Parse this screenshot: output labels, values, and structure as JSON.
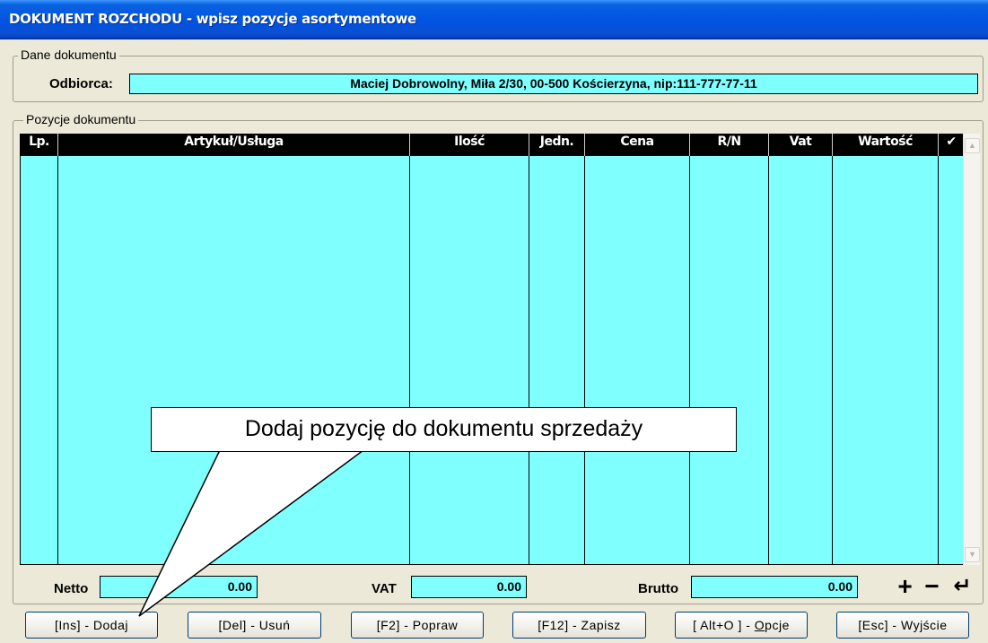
{
  "window": {
    "title": "DOKUMENT ROZCHODU - wpisz pozycje asortymentowe"
  },
  "dane": {
    "legend": "Dane dokumentu",
    "odbiorca_label": "Odbiorca:",
    "odbiorca_value": "Maciej Dobrowolny,  Miła 2/30,  00-500 Kościerzyna,  nip:111-777-77-11"
  },
  "pozycje": {
    "legend": "Pozycje dokumentu",
    "columns": [
      "Lp.",
      "Artykuł/Usługa",
      "Ilość",
      "Jedn.",
      "Cena",
      "R/N",
      "Vat",
      "Wartość",
      "✔"
    ],
    "rows": []
  },
  "totals": {
    "netto_label": "Netto",
    "netto_value": "0.00",
    "vat_label": "VAT",
    "vat_value": "0.00",
    "brutto_label": "Brutto",
    "brutto_value": "0.00"
  },
  "controls": {
    "plus": "+",
    "minus": "−",
    "enter": "↵"
  },
  "buttons": {
    "dodaj": "[Ins] - Dodaj",
    "usun": "[Del] - Usuń",
    "popraw": "[F2] - Popraw",
    "zapisz": "[F12] - Zapisz",
    "opcje_prefix": "[ Alt+O ] - ",
    "opcje_key": "O",
    "opcje_rest": "pcje",
    "wyjscie": "[Esc] - Wyjście"
  },
  "callout": {
    "text": "Dodaj pozycję do dokumentu sprzedaży"
  },
  "colors": {
    "field": "#80ffff",
    "titlebar": "#0054e3",
    "window_bg": "#ece9d8"
  }
}
